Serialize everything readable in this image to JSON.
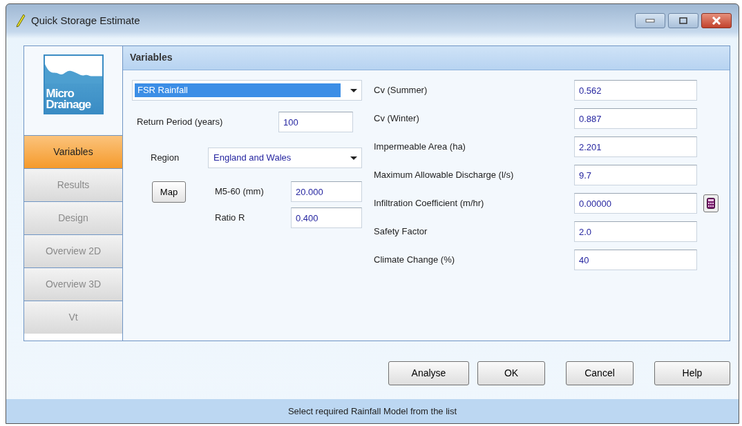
{
  "window": {
    "title": "Quick Storage Estimate"
  },
  "logo": {
    "lines": [
      "Micro",
      "Drainage"
    ]
  },
  "tabs": [
    {
      "label": "Variables",
      "selected": true
    },
    {
      "label": "Results",
      "selected": false
    },
    {
      "label": "Design",
      "selected": false
    },
    {
      "label": "Overview 2D",
      "selected": false
    },
    {
      "label": "Overview 3D",
      "selected": false
    },
    {
      "label": "Vt",
      "selected": false
    }
  ],
  "panel": {
    "title": "Variables"
  },
  "rainfall_model": {
    "value": "FSR Rainfall",
    "highlighted": true
  },
  "return_period": {
    "label": "Return Period (years)",
    "value": "100"
  },
  "region": {
    "label": "Region",
    "value": "England and Wales"
  },
  "map_button": "Map",
  "m5_60": {
    "label": "M5-60 (mm)",
    "value": "20.000"
  },
  "ratio_r": {
    "label": "Ratio R",
    "value": "0.400"
  },
  "variables": [
    {
      "label": "Cv (Summer)",
      "value": "0.562",
      "calculator": false
    },
    {
      "label": "Cv (Winter)",
      "value": "0.887",
      "calculator": false
    },
    {
      "label": "Impermeable Area (ha)",
      "value": "2.201",
      "calculator": false
    },
    {
      "label": "Maximum Allowable Discharge (l/s)",
      "value": "9.7",
      "calculator": false
    },
    {
      "label": "Infiltration Coefficient (m/hr)",
      "value": "0.00000",
      "calculator": true
    },
    {
      "label": "Safety Factor",
      "value": "2.0",
      "calculator": false
    },
    {
      "label": "Climate Change (%)",
      "value": "40",
      "calculator": false
    }
  ],
  "buttons": [
    "Analyse",
    "OK",
    "Cancel",
    "Help"
  ],
  "status_bar": "Select required Rainfall Model from the list"
}
